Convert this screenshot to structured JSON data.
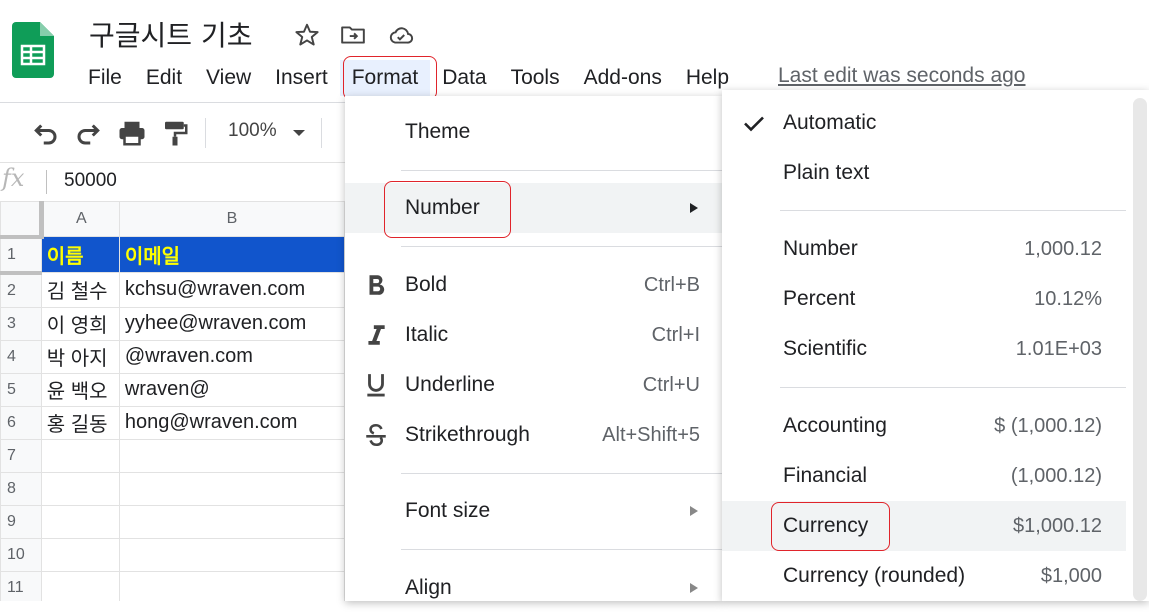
{
  "header": {
    "doc_title": "구글시트 기초",
    "menu": [
      "File",
      "Edit",
      "View",
      "Insert",
      "Format",
      "Data",
      "Tools",
      "Add-ons",
      "Help"
    ],
    "last_edit": "Last edit was seconds ago"
  },
  "toolbar": {
    "zoom": "100%"
  },
  "formula_bar": {
    "fx": "fx",
    "value": "50000"
  },
  "sheet": {
    "columns": [
      "A",
      "B"
    ],
    "rows": [
      {
        "num": "1",
        "a": "이름",
        "b": "이메일"
      },
      {
        "num": "2",
        "a": "김 철수",
        "b": "kchsu@wraven.com"
      },
      {
        "num": "3",
        "a": "이 영희",
        "b": "yyhee@wraven.com"
      },
      {
        "num": "4",
        "a": "박 아지",
        "b": "@wraven.com"
      },
      {
        "num": "5",
        "a": "윤 백오",
        "b": "wraven@"
      },
      {
        "num": "6",
        "a": "홍 길동",
        "b": "hong@wraven.com"
      },
      {
        "num": "7",
        "a": "",
        "b": ""
      },
      {
        "num": "8",
        "a": "",
        "b": ""
      },
      {
        "num": "9",
        "a": "",
        "b": ""
      },
      {
        "num": "10",
        "a": "",
        "b": ""
      },
      {
        "num": "11",
        "a": "",
        "b": ""
      }
    ],
    "header_fill": "#1155cc",
    "header_text_color": "#ffff00"
  },
  "format_menu": {
    "theme": "Theme",
    "number": "Number",
    "bold": {
      "label": "Bold",
      "shortcut": "Ctrl+B"
    },
    "italic": {
      "label": "Italic",
      "shortcut": "Ctrl+I"
    },
    "underline": {
      "label": "Underline",
      "shortcut": "Ctrl+U"
    },
    "strikethrough": {
      "label": "Strikethrough",
      "shortcut": "Alt+Shift+5"
    },
    "font_size": "Font size",
    "align": "Align"
  },
  "number_submenu": {
    "automatic": "Automatic",
    "plain_text": "Plain text",
    "number": {
      "label": "Number",
      "example": "1,000.12"
    },
    "percent": {
      "label": "Percent",
      "example": "10.12%"
    },
    "scientific": {
      "label": "Scientific",
      "example": "1.01E+03"
    },
    "accounting": {
      "label": "Accounting",
      "example": "$ (1,000.12)"
    },
    "financial": {
      "label": "Financial",
      "example": "(1,000.12)"
    },
    "currency": {
      "label": "Currency",
      "example": "$1,000.12"
    },
    "currency_rounded": {
      "label": "Currency (rounded)",
      "example": "$1,000"
    }
  },
  "colors": {
    "sheets_green": "#0f9d58",
    "highlight_red": "#e0242b"
  }
}
